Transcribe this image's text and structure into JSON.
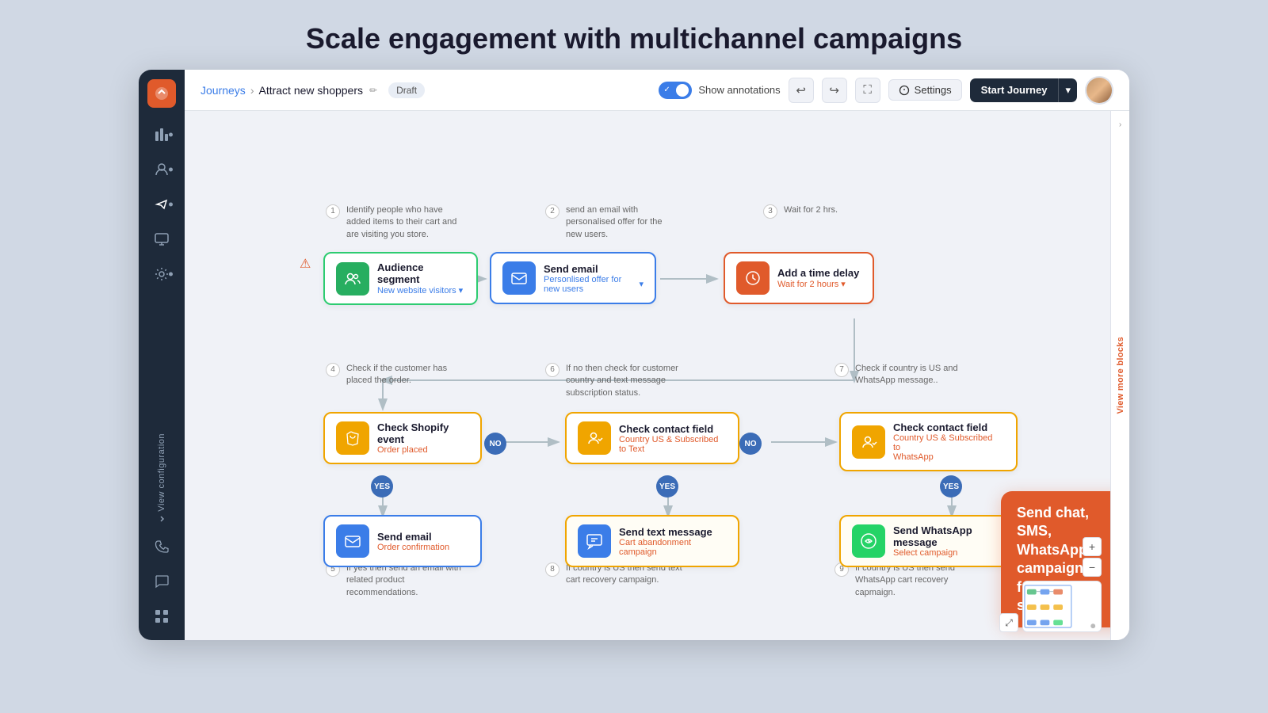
{
  "page": {
    "title": "Scale engagement with multichannel campaigns"
  },
  "breadcrumb": {
    "journeys_label": "Journeys",
    "current_label": "Attract new shoppers",
    "status_badge": "Draft"
  },
  "toolbar": {
    "show_annotations": "Show annotations",
    "settings_label": "Settings",
    "start_journey_label": "Start Journey"
  },
  "sidebar": {
    "items": [
      {
        "id": "megaphone",
        "icon": "📣",
        "active": true
      },
      {
        "id": "chart",
        "icon": "📊",
        "active": false
      },
      {
        "id": "user",
        "icon": "👤",
        "active": false
      },
      {
        "id": "megaphone2",
        "icon": "📢",
        "active": true
      },
      {
        "id": "monitor",
        "icon": "🖥",
        "active": false
      },
      {
        "id": "gear",
        "icon": "⚙",
        "active": false
      }
    ],
    "bottom": [
      {
        "id": "phone",
        "icon": "📞"
      },
      {
        "id": "chat",
        "icon": "💬"
      },
      {
        "id": "grid",
        "icon": "⊞"
      }
    ],
    "view_config_label": "View configuration"
  },
  "nodes": {
    "audience_segment": {
      "title": "Audience segment",
      "sub": "New website visitors"
    },
    "send_email_1": {
      "title": "Send email",
      "sub": "Personlised offer for new users"
    },
    "add_time_delay": {
      "title": "Add a time delay",
      "sub": "Wait for 2 hours"
    },
    "check_shopify": {
      "title": "Check Shopify event",
      "sub": "Order placed"
    },
    "check_contact_field_1": {
      "title": "Check contact field",
      "sub": "Country US & Subscribed to Text"
    },
    "check_contact_field_2": {
      "title": "Check contact field",
      "sub": "Country US & Subscribed to WhatsApp"
    },
    "send_email_2": {
      "title": "Send email",
      "sub": "Order confirmation"
    },
    "send_text": {
      "title": "Send text message",
      "sub": "Cart abandonment campaign"
    },
    "send_whatsapp": {
      "title": "Send WhatsApp message",
      "sub": "Select campaign"
    }
  },
  "annotations": {
    "a1": "Identify people who have added items to their cart and are visiting you store.",
    "a2": "send an email with personalised offer for the new users.",
    "a3": "Wait for 2 hrs.",
    "a4": "Check if the customer has placed the order.",
    "a5": "If yes then send an email with related product recommendations.",
    "a6": "If no then check for customer country and text message subscription status.",
    "a7": "Check if country is US and WhatsApp message..",
    "a8": "If country is US then send text cart recovery campaign.",
    "a9": "If country is US then send WhatsApp cart recovery capmaign."
  },
  "tooltip": {
    "text": "Send chat, SMS, WhatsApp campaigns from one solution"
  },
  "right_panel": {
    "view_more_blocks": "View more blocks"
  }
}
